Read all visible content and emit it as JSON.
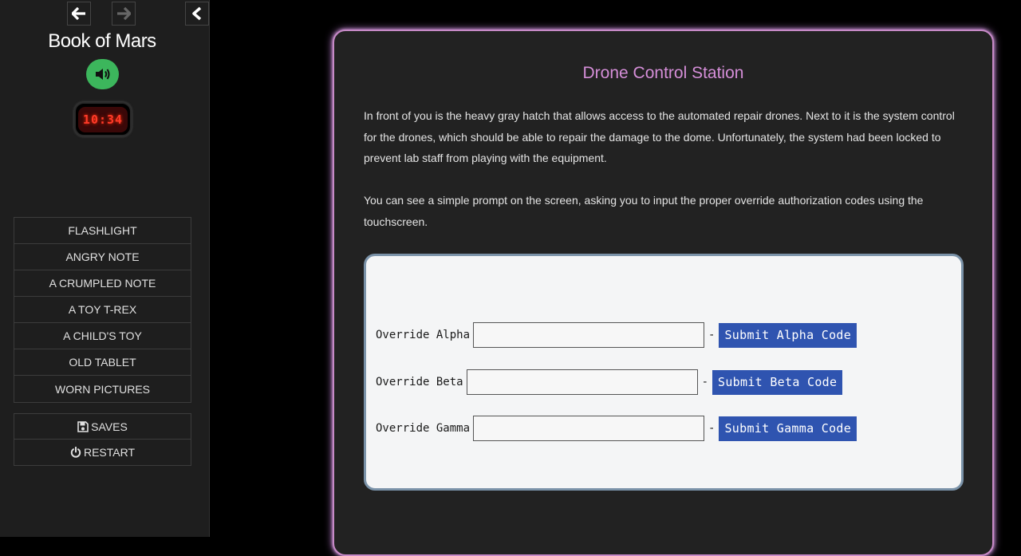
{
  "sidebar": {
    "title": "Book of Mars",
    "clock": "10:34",
    "inventory": [
      {
        "label": "FLASHLIGHT"
      },
      {
        "label": "ANGRY NOTE"
      },
      {
        "label": "A CRUMPLED NOTE"
      },
      {
        "label": "A TOY T-REX"
      },
      {
        "label": "A CHILD'S TOY"
      },
      {
        "label": "OLD TABLET"
      },
      {
        "label": "WORN PICTURES"
      }
    ],
    "system": {
      "saves_label": "SAVES",
      "restart_label": "RESTART"
    },
    "icons": {
      "back": "arrow-left-icon",
      "forward": "arrow-right-icon",
      "collapse": "chevron-left-icon",
      "audio": "speaker-icon",
      "saves": "floppy-disk-icon",
      "restart": "power-icon"
    },
    "colors": {
      "audio_button": "#3cb65c",
      "clock_digits": "#ff3a2a"
    }
  },
  "passage": {
    "title": "Drone Control Station",
    "paragraphs": [
      "In front of you is the heavy gray hatch that allows access to the automated repair drones. Next to it is the system control for the drones, which should be able to repair the damage to the dome. Unfortunately, the system had been locked to prevent lab staff from playing with the equipment.",
      "You can see a simple prompt on the screen, asking you to input the proper override authorization codes using the touchscreen."
    ],
    "colors": {
      "title": "#d58ed8",
      "glow": "#b478c8"
    }
  },
  "terminal": {
    "rows": [
      {
        "label": "Override Alpha",
        "value": "",
        "separator": "-",
        "button": "Submit Alpha Code"
      },
      {
        "label": "Override Beta",
        "value": "",
        "separator": "-",
        "button": "Submit Beta Code"
      },
      {
        "label": "Override Gamma",
        "value": "",
        "separator": "-",
        "button": "Submit Gamma Code"
      }
    ],
    "colors": {
      "button": "#2f54b0",
      "border": "#7a92a8"
    }
  }
}
